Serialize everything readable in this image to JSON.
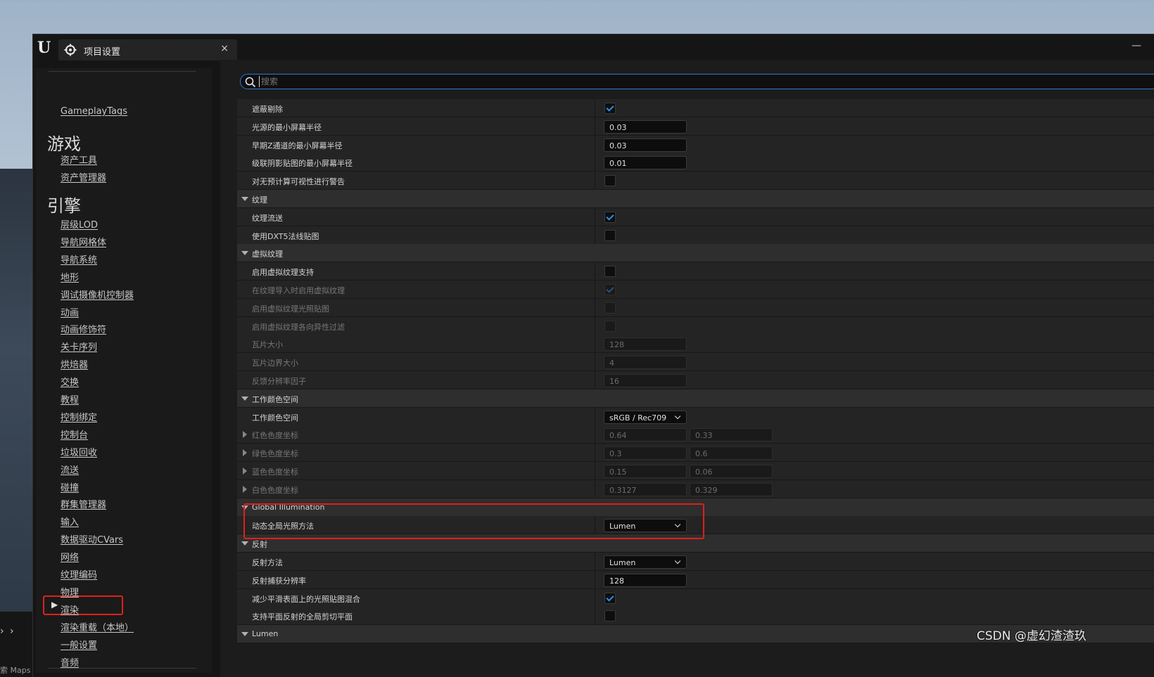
{
  "window": {
    "tab_title": "项目设置",
    "close_glyph": "×",
    "minimize_glyph": "—"
  },
  "background": {
    "bottom_label": "索 Maps",
    "chevron": "›"
  },
  "search": {
    "placeholder": "搜索"
  },
  "sidebar": {
    "top_item": "GameplayTags",
    "sections": [
      {
        "heading": "游戏",
        "items": [
          "资产工具",
          "资产管理器"
        ]
      },
      {
        "heading": "引擎",
        "items": [
          "层级LOD",
          "导航网格体",
          "导航系统",
          "地形",
          "调试摄像机控制器",
          "动画",
          "动画修饰符",
          "关卡序列",
          "烘焙器",
          "交换",
          "教程",
          "控制绑定",
          "控制台",
          "垃圾回收",
          "流送",
          "碰撞",
          "群集管理器",
          "输入",
          "数据驱动CVars",
          "网络",
          "纹理编码",
          "物理",
          "渲染",
          "渲染重载（本地）",
          "一般设置",
          "音频"
        ]
      }
    ],
    "selected_item": "渲染",
    "selected_arrow": "▶"
  },
  "properties": [
    {
      "type": "check",
      "label": "遮蔽剔除",
      "checked": true
    },
    {
      "type": "num",
      "label": "光源的最小屏幕半径",
      "value": "0.03"
    },
    {
      "type": "num",
      "label": "早期Z通道的最小屏幕半径",
      "value": "0.03"
    },
    {
      "type": "num",
      "label": "级联阴影贴图的最小屏幕半径",
      "value": "0.01"
    },
    {
      "type": "check",
      "label": "对无预计算可视性进行警告",
      "checked": false
    },
    {
      "type": "cat",
      "label": "纹理"
    },
    {
      "type": "check",
      "label": "纹理流送",
      "checked": true
    },
    {
      "type": "check",
      "label": "使用DXT5法线贴图",
      "checked": false
    },
    {
      "type": "cat",
      "label": "虚拟纹理"
    },
    {
      "type": "check",
      "label": "启用虚拟纹理支持",
      "checked": false
    },
    {
      "type": "check",
      "label": "在纹理导入时启用虚拟纹理",
      "checked": true,
      "disabled": true
    },
    {
      "type": "check",
      "label": "启用虚拟纹理光照贴图",
      "checked": false,
      "disabled": true
    },
    {
      "type": "check",
      "label": "启用虚拟纹理各向异性过滤",
      "checked": false,
      "disabled": true
    },
    {
      "type": "num",
      "label": "瓦片大小",
      "value": "128",
      "disabled": true
    },
    {
      "type": "num",
      "label": "瓦片边界大小",
      "value": "4",
      "disabled": true
    },
    {
      "type": "num",
      "label": "反馈分辨率因子",
      "value": "16",
      "disabled": true
    },
    {
      "type": "cat",
      "label": "工作颜色空间"
    },
    {
      "type": "dropdown",
      "label": "工作颜色空间",
      "value": "sRGB / Rec709"
    },
    {
      "type": "pair",
      "label": "红色色度坐标",
      "values": [
        "0.64",
        "0.33"
      ],
      "disabled": true
    },
    {
      "type": "pair",
      "label": "绿色色度坐标",
      "values": [
        "0.3",
        "0.6"
      ],
      "disabled": true
    },
    {
      "type": "pair",
      "label": "蓝色色度坐标",
      "values": [
        "0.15",
        "0.06"
      ],
      "disabled": true
    },
    {
      "type": "pair",
      "label": "白色色度坐标",
      "values": [
        "0.3127",
        "0.329"
      ],
      "disabled": true
    },
    {
      "type": "cat",
      "label": "Global Illumination"
    },
    {
      "type": "dropdown",
      "label": "动态全局光照方法",
      "value": "Lumen"
    },
    {
      "type": "cat",
      "label": "反射"
    },
    {
      "type": "dropdown",
      "label": "反射方法",
      "value": "Lumen"
    },
    {
      "type": "num",
      "label": "反射捕获分辨率",
      "value": "128"
    },
    {
      "type": "check",
      "label": "减少平滑表面上的光照贴图混合",
      "checked": true
    },
    {
      "type": "check",
      "label": "支持平面反射的全局剪切平面",
      "checked": false
    },
    {
      "type": "cat",
      "label": "Lumen"
    }
  ],
  "watermark": "CSDN @虚幻渣渣玖",
  "colors": {
    "accent_blue": "#2f8cf0",
    "highlight_red": "#e0201a"
  }
}
